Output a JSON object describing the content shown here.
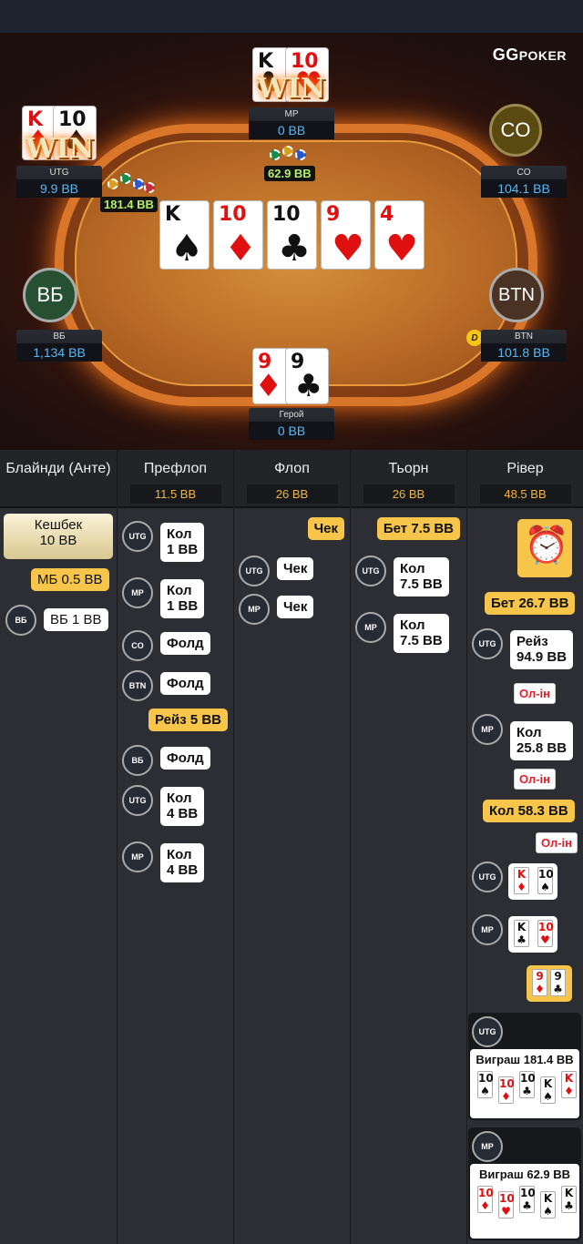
{
  "logo": {
    "text": "GG",
    "sub": "POKER"
  },
  "board": [
    {
      "rank": "K",
      "suit": "♠",
      "color": "blk"
    },
    {
      "rank": "10",
      "suit": "♦",
      "color": "red"
    },
    {
      "rank": "10",
      "suit": "♣",
      "color": "blk"
    },
    {
      "rank": "9",
      "suit": "♥",
      "color": "red"
    },
    {
      "rank": "4",
      "suit": "♥",
      "color": "red"
    }
  ],
  "seats": {
    "mp": {
      "name": "MP",
      "stack": "0 BB",
      "cards": [
        {
          "rank": "K",
          "suit": "♣",
          "color": "blk"
        },
        {
          "rank": "10",
          "suit": "♥",
          "color": "red"
        }
      ],
      "win": "WIN",
      "pot": "62.9 BB"
    },
    "utg": {
      "name": "UTG",
      "stack": "9.9 BB",
      "cards": [
        {
          "rank": "K",
          "suit": "♦",
          "color": "red"
        },
        {
          "rank": "10",
          "suit": "♠",
          "color": "blk"
        }
      ],
      "win": "WIN",
      "pot": "181.4 BB"
    },
    "co": {
      "name": "CO",
      "stack": "104.1 BB",
      "label": "CO"
    },
    "bb": {
      "name": "ВБ",
      "stack": "1,134 BB",
      "label": "ВБ"
    },
    "btn": {
      "name": "BTN",
      "stack": "101.8 BB",
      "label": "BTN",
      "dealer": "D"
    },
    "hero": {
      "name": "Герой",
      "stack": "0 BB",
      "cards": [
        {
          "rank": "9",
          "suit": "♦",
          "color": "red"
        },
        {
          "rank": "9",
          "suit": "♣",
          "color": "blk"
        }
      ]
    }
  },
  "columns": [
    {
      "title": "Блайнди (Анте)",
      "pot": ""
    },
    {
      "title": "Префлоп",
      "pot": "11.5 BB"
    },
    {
      "title": "Флоп",
      "pot": "26 BB"
    },
    {
      "title": "Тьорн",
      "pot": "26 BB"
    },
    {
      "title": "Рівер",
      "pot": "48.5 BB"
    }
  ],
  "blinds": {
    "cashback": "Кешбек\n10 BB",
    "sb": "МБ 0.5 BB",
    "bb_av": "ВБ",
    "bb": "ВБ 1 BB"
  },
  "preflop": [
    {
      "av": "UTG",
      "text": "Кол\n1 BB"
    },
    {
      "av": "MP",
      "text": "Кол\n1 BB"
    },
    {
      "av": "CO",
      "text": "Фолд"
    },
    {
      "av": "BTN",
      "text": "Фолд"
    },
    {
      "av": "",
      "text": "Рейз 5 BB"
    },
    {
      "av": "ВБ",
      "text": "Фолд"
    },
    {
      "av": "UTG",
      "text": "Кол\n4 BB"
    },
    {
      "av": "MP",
      "text": "Кол\n4 BB"
    }
  ],
  "flop": [
    {
      "text": "Чек"
    },
    {
      "av": "UTG",
      "text": "Чек"
    },
    {
      "av": "MP",
      "text": "Чек"
    }
  ],
  "turn": [
    {
      "text": "Бет 7.5 BB"
    },
    {
      "av": "UTG",
      "text": "Кол\n7.5 BB"
    },
    {
      "av": "MP",
      "text": "Кол\n7.5 BB"
    }
  ],
  "river": {
    "bet": "Бет 26.7 BB",
    "utg": "Рейз\n94.9 BB",
    "utg_allin": "Ол-ін",
    "mp": "Кол\n25.8 BB",
    "mp_allin": "Ол-ін",
    "hero": "Кол 58.3 BB",
    "hero_allin": "Ол-ін",
    "utg_av": "UTG",
    "mp_av": "MP",
    "show_utg": [
      {
        "rank": "K",
        "suit": "♦",
        "color": "red"
      },
      {
        "rank": "10",
        "suit": "♠",
        "color": "blk"
      }
    ],
    "show_mp": [
      {
        "rank": "K",
        "suit": "♣",
        "color": "blk"
      },
      {
        "rank": "10",
        "suit": "♥",
        "color": "red"
      }
    ],
    "show_hero": [
      {
        "rank": "9",
        "suit": "♦",
        "color": "red"
      },
      {
        "rank": "9",
        "suit": "♣",
        "color": "blk"
      }
    ],
    "win_utg": "Виграш 181.4 BB",
    "win_mp": "Виграш 62.9 BB",
    "win_cards_utg": [
      {
        "rank": "10",
        "suit": "♦",
        "color": "red"
      },
      {
        "rank": "10",
        "suit": "♣",
        "color": "blk"
      },
      {
        "rank": "K",
        "suit": "♠",
        "color": "blk"
      },
      {
        "rank": "K",
        "suit": "♦",
        "color": "red"
      }
    ],
    "win_cards_utg_lead": {
      "rank": "10",
      "suit": "♠",
      "color": "blk"
    },
    "win_cards_mp": [
      {
        "rank": "10",
        "suit": "♥",
        "color": "red"
      },
      {
        "rank": "10",
        "suit": "♣",
        "color": "blk"
      },
      {
        "rank": "K",
        "suit": "♠",
        "color": "blk"
      },
      {
        "rank": "K",
        "suit": "♣",
        "color": "blk"
      }
    ],
    "win_cards_mp_lead": {
      "rank": "10",
      "suit": "♦",
      "color": "red"
    }
  },
  "colors": {
    "accent": "#f6c54a",
    "stack_blue": "#58b8f5",
    "allin_red": "#e0202a"
  }
}
